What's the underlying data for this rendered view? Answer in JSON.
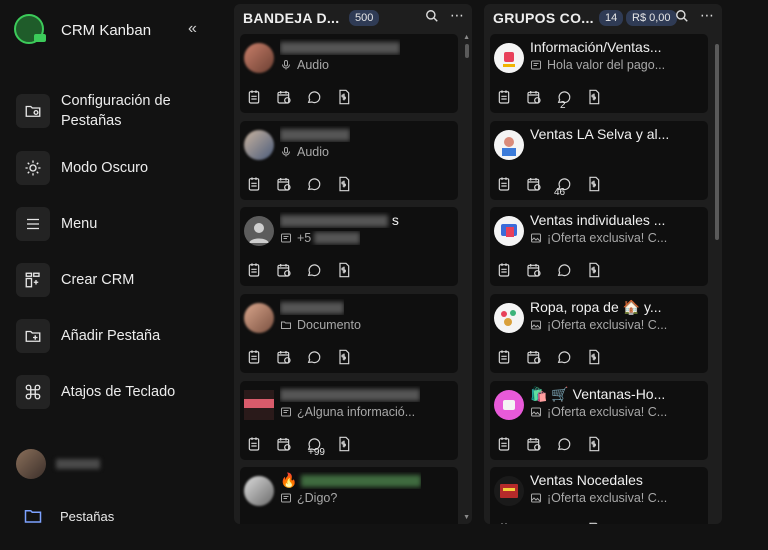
{
  "app": {
    "title": "CRM Kanban",
    "collapse_icon": "double-chevron-left-icon"
  },
  "sidebar": {
    "items": [
      {
        "label": "Configuración de Pestañas",
        "icon": "folder-gear-icon"
      },
      {
        "label": "Modo Oscuro",
        "icon": "sun-icon"
      },
      {
        "label": "Menu",
        "icon": "menu-icon"
      },
      {
        "label": "Crear CRM",
        "icon": "columns-add-icon"
      },
      {
        "label": "Añadir Pestaña",
        "icon": "folder-plus-icon"
      },
      {
        "label": "Atajos de Teclado",
        "icon": "command-icon"
      }
    ],
    "tabs_label": "Pestañas"
  },
  "columns": [
    {
      "title": "BANDEJA D...",
      "count": "500",
      "cards": [
        {
          "sub": "Audio",
          "sub_icon": "microphone-icon",
          "count": ""
        },
        {
          "sub": "Audio",
          "sub_icon": "microphone-icon",
          "count": ""
        },
        {
          "name_suffix": "s",
          "sub": "+5",
          "sub_icon": "message-icon",
          "count": ""
        },
        {
          "sub": "Documento",
          "sub_icon": "folder-icon",
          "count": ""
        },
        {
          "sub": "¿Alguna informació...",
          "sub_icon": "message-icon",
          "count": "+99"
        },
        {
          "sub": "¿Digo?",
          "sub_icon": "message-icon",
          "count": ""
        }
      ]
    },
    {
      "title": "GRUPOS CO...",
      "count": "14",
      "amount": "R$ 0,00",
      "cards": [
        {
          "name": "Información/Ventas...",
          "sub": "Hola valor del pago...",
          "sub_icon": "message-icon",
          "count": "2"
        },
        {
          "name": "Ventas LA Selva y al...",
          "sub": "",
          "sub_icon": "",
          "count": "46"
        },
        {
          "name": "Ventas individuales ...",
          "sub": "¡Oferta exclusiva! C...",
          "sub_icon": "image-icon",
          "count": ""
        },
        {
          "name": "Ropa, ropa de 🏠 y...",
          "sub": "¡Oferta exclusiva! C...",
          "sub_icon": "image-icon",
          "count": ""
        },
        {
          "name": "🛍️ 🛒 Ventanas-Ho...",
          "sub": "¡Oferta exclusiva! C...",
          "sub_icon": "image-icon",
          "count": ""
        },
        {
          "name": "Ventas Nocedales",
          "sub": "¡Oferta exclusiva! C...",
          "sub_icon": "image-icon",
          "count": ""
        }
      ]
    }
  ],
  "colors": {
    "background": "#121212",
    "column": "#1e1e1e",
    "card": "#0f0f0f",
    "badge": "#2f3b55",
    "accent": "#4c8dff"
  }
}
